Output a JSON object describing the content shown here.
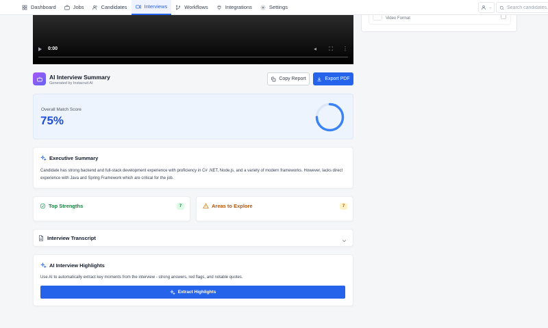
{
  "nav": {
    "items": [
      {
        "label": "Dashboard",
        "icon": "grid-icon"
      },
      {
        "label": "Jobs",
        "icon": "briefcase-icon"
      },
      {
        "label": "Candidates",
        "icon": "users-icon"
      },
      {
        "label": "Interviews",
        "icon": "video-icon"
      },
      {
        "label": "Workflows",
        "icon": "branch-icon"
      },
      {
        "label": "Integrations",
        "icon": "plug-icon"
      },
      {
        "label": "Settings",
        "icon": "gear-icon"
      }
    ],
    "active": "Interviews",
    "search_placeholder": "Search candidates..."
  },
  "video": {
    "time": "0:00",
    "format_label": "Video Format"
  },
  "summary": {
    "title": "AI Interview Summary",
    "subtitle": "Generated by Instacruit AI",
    "copy_label": "Copy Report",
    "export_label": "Export PDF"
  },
  "match": {
    "label": "Overall Match Score",
    "value": "75%",
    "fraction": 0.75
  },
  "executive": {
    "title": "Executive Summary",
    "text": "Candidate has strong backend and full-stack development experience with proficiency in C# .NET, Node.js, and a variety of modern frameworks. However, lacks direct experience with Java and Spring Framework which are critical for the job."
  },
  "strengths": {
    "title": "Top Strengths",
    "count": "7"
  },
  "explore": {
    "title": "Areas to Explore",
    "count": "7"
  },
  "transcript": {
    "title": "Interview Transcript"
  },
  "highlights": {
    "title": "AI Interview Highlights",
    "text": "Use AI to automatically extract key moments from the interview - strong answers, red flags, and notable quotes.",
    "button_label": "Extract Highlights"
  },
  "colors": {
    "accent": "#2563eb",
    "success": "#16a34a",
    "warning": "#d97706"
  }
}
